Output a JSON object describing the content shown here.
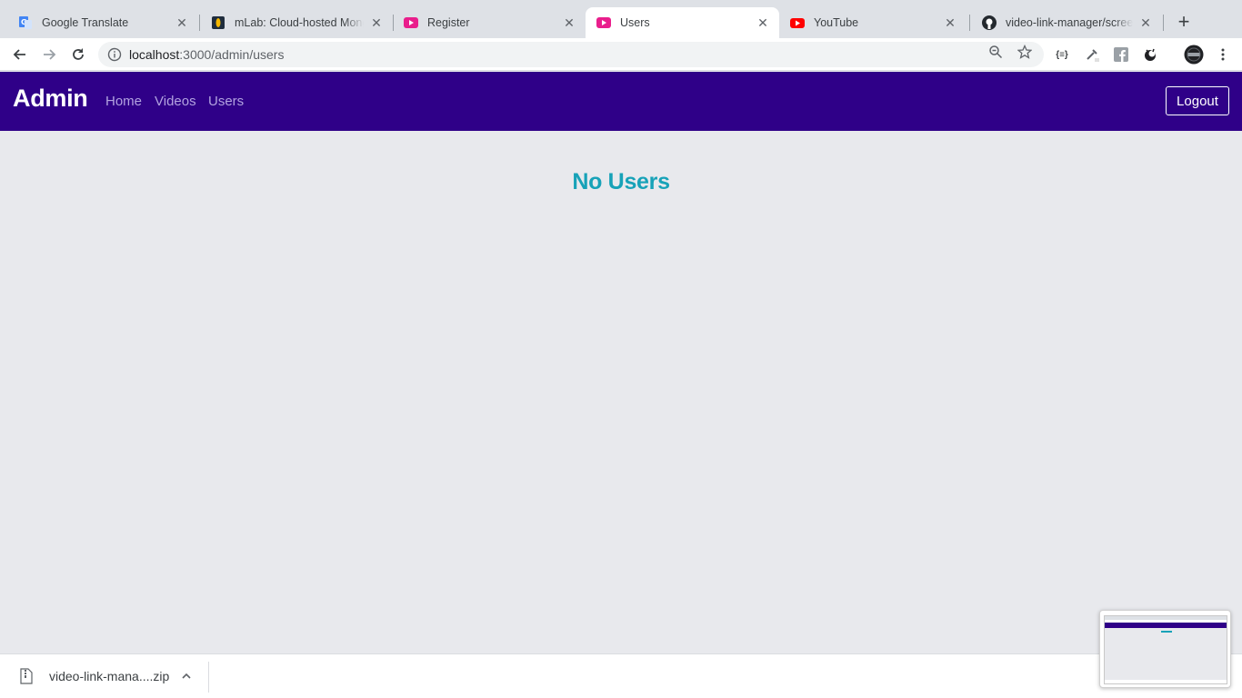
{
  "browser": {
    "tabs": [
      {
        "title": "Google Translate",
        "icon": "google-translate-icon",
        "active": false
      },
      {
        "title": "mLab: Cloud-hosted MongoDB",
        "icon": "mlab-icon",
        "active": false
      },
      {
        "title": "Register",
        "icon": "video-app-icon",
        "active": false
      },
      {
        "title": "Users",
        "icon": "video-app-icon",
        "active": true
      },
      {
        "title": "YouTube",
        "icon": "youtube-icon",
        "active": false
      },
      {
        "title": "video-link-manager/screenshots",
        "icon": "github-icon",
        "active": false
      }
    ],
    "url_host": "localhost",
    "url_rest": ":3000/admin/users"
  },
  "navbar": {
    "brand": "Admin",
    "links": [
      "Home",
      "Videos",
      "Users"
    ],
    "logout_label": "Logout"
  },
  "main": {
    "heading": "No Users"
  },
  "downloads": {
    "filename": "video-link-mana....zip"
  },
  "colors": {
    "navbar_bg": "#2f0088",
    "heading": "#17a2b8",
    "page_bg": "#e8e9ed"
  }
}
